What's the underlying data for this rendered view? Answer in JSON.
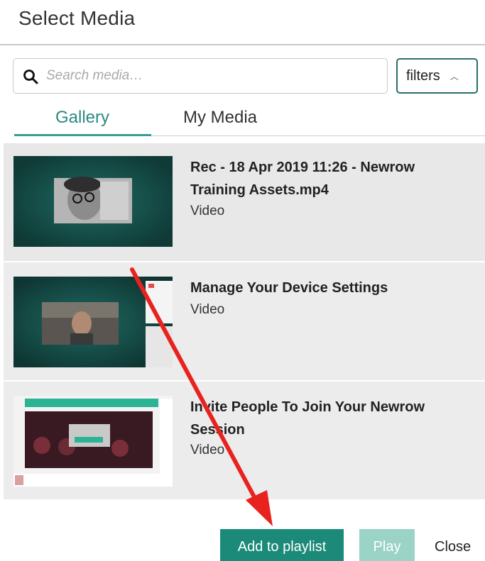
{
  "header": {
    "title": "Select Media"
  },
  "search": {
    "placeholder": "Search media…",
    "value": ""
  },
  "filters": {
    "label": "filters"
  },
  "tabs": [
    {
      "label": "Gallery",
      "active": true
    },
    {
      "label": "My Media",
      "active": false
    }
  ],
  "media": [
    {
      "title": "Rec - 18 Apr 2019 11:26 - Newrow Training Assets.mp4",
      "type": "Video"
    },
    {
      "title": "Manage Your Device Settings",
      "type": "Video"
    },
    {
      "title": "Invite People To Join Your Newrow Session",
      "type": "Video"
    }
  ],
  "footer": {
    "add_label": "Add to playlist",
    "play_label": "Play",
    "close_label": "Close"
  },
  "colors": {
    "accent": "#1c8a79",
    "tab_active": "#2a8a80",
    "annotation_arrow": "#e8231f"
  }
}
